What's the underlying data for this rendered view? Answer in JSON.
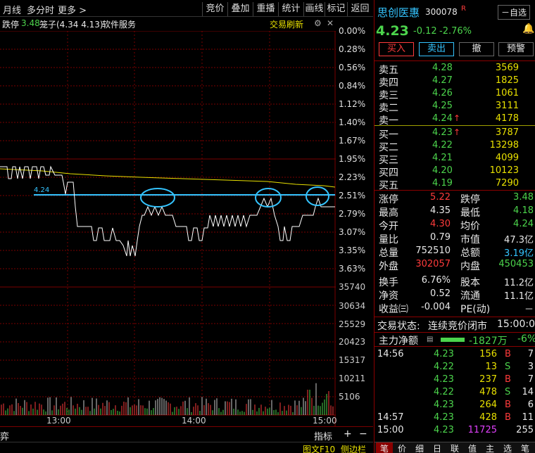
{
  "toolbar": {
    "month": "月线",
    "multi": "多分时",
    "more": "更多 >",
    "tabs": [
      "竞价",
      "叠加",
      "重播",
      "统计",
      "画线",
      "标记",
      "返回"
    ]
  },
  "subheader": {
    "limit_down": "跌停",
    "limit_down_val": "3.48",
    "cage": "笼子(4.34 4.13)",
    "industry": "软件服务",
    "refresh": "交易刷新"
  },
  "chart": {
    "pct_labels": [
      "0.00%",
      "0.28%",
      "0.56%",
      "0.84%",
      "1.12%",
      "1.40%",
      "1.67%",
      "1.95%",
      "2.23%",
      "2.51%",
      "2.79%",
      "3.07%",
      "3.35%",
      "3.63%"
    ],
    "vol_labels": [
      "35740",
      "30634",
      "25529",
      "20423",
      "15317",
      "10211",
      "5106"
    ],
    "hline_label": "4.24",
    "times": [
      "13:00",
      "14:00",
      "15:00"
    ]
  },
  "bottom": {
    "left": "弈",
    "indicator": "指标",
    "plus": "+",
    "minus": "−",
    "f10": "图文F10",
    "sidebar": "侧边栏"
  },
  "stock": {
    "name": "思创医惠",
    "code": "300078",
    "r": "R",
    "watch": "－自选",
    "price": "4.23",
    "change": "-0.12",
    "pct": "-2.76%"
  },
  "actions": {
    "buy": "买入",
    "sell": "卖出",
    "cancel": "撤",
    "alert": "预警"
  },
  "asks": [
    {
      "label": "卖五",
      "price": "4.28",
      "vol": "3569"
    },
    {
      "label": "卖四",
      "price": "4.27",
      "vol": "1825"
    },
    {
      "label": "卖三",
      "price": "4.26",
      "vol": "1061"
    },
    {
      "label": "卖二",
      "price": "4.25",
      "vol": "3111"
    },
    {
      "label": "卖一",
      "price": "4.24",
      "vol": "4178"
    }
  ],
  "bids": [
    {
      "label": "买一",
      "price": "4.23",
      "vol": "3787"
    },
    {
      "label": "买二",
      "price": "4.22",
      "vol": "13298"
    },
    {
      "label": "买三",
      "price": "4.21",
      "vol": "4099"
    },
    {
      "label": "买四",
      "price": "4.20",
      "vol": "10123"
    },
    {
      "label": "买五",
      "price": "4.19",
      "vol": "7290"
    }
  ],
  "stats": [
    {
      "l1": "涨停",
      "v1": "5.22",
      "l2": "跌停",
      "v2": "3.48"
    },
    {
      "l1": "最高",
      "v1": "4.35",
      "l2": "最低",
      "v2": "4.18"
    },
    {
      "l1": "今开",
      "v1": "4.30",
      "l2": "均价",
      "v2": "4.24"
    },
    {
      "l1": "量比",
      "v1": "0.79",
      "l2": "市值",
      "v2": "47.3亿"
    },
    {
      "l1": "总量",
      "v1": "752510",
      "l2": "总额",
      "v2": "3.19亿"
    },
    {
      "l1": "外盘",
      "v1": "302057",
      "l2": "内盘",
      "v2": "450453"
    },
    {
      "l1": "换手",
      "v1": "6.76%",
      "l2": "股本",
      "v2": "11.2亿"
    },
    {
      "l1": "净资",
      "v1": "0.52",
      "l2": "流通",
      "v2": "11.1亿"
    },
    {
      "l1": "收益㈢",
      "v1": "-0.004",
      "l2": "PE(动)",
      "v2": "－"
    }
  ],
  "status": {
    "label": "交易状态:",
    "value": "连续竞价闭市",
    "time": "15:00:00"
  },
  "flow": {
    "label": "主力净额",
    "value": "-1827万",
    "pct": "-6%"
  },
  "ticks": [
    {
      "t": "14:56",
      "p": "4.23",
      "v": "156",
      "s": "B",
      "n": "7"
    },
    {
      "t": "",
      "p": "4.22",
      "v": "13",
      "s": "S",
      "n": "3"
    },
    {
      "t": "",
      "p": "4.23",
      "v": "237",
      "s": "B",
      "n": "7"
    },
    {
      "t": "",
      "p": "4.22",
      "v": "478",
      "s": "S",
      "n": "14"
    },
    {
      "t": "",
      "p": "4.23",
      "v": "264",
      "s": "B",
      "n": "6"
    },
    {
      "t": "14:57",
      "p": "4.23",
      "v": "428",
      "s": "B",
      "n": "11"
    },
    {
      "t": "15:00",
      "p": "4.23",
      "v": "11725",
      "s": "",
      "n": "255"
    }
  ],
  "bottom_tabs": [
    "笔",
    "价",
    "细",
    "日",
    "联",
    "值",
    "主",
    "选",
    "笔"
  ]
}
